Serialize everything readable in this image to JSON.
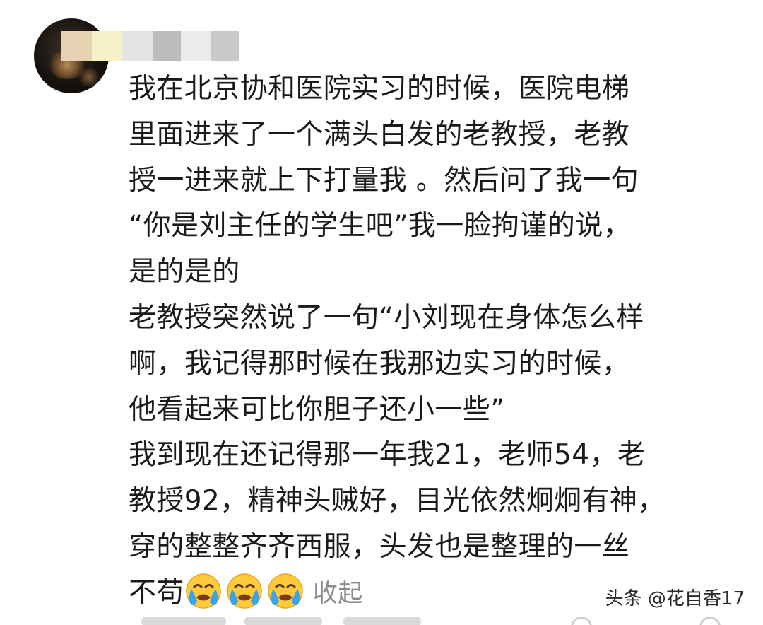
{
  "comment": {
    "lines": [
      "我在北京协和医院实习的时候，医院电梯",
      "里面进来了一个满头白发的老教授，老教",
      "授一进来就上下打量我 。然后问了我一句",
      "“你是刘主任的学生吧”我一脸拘谨的说，",
      "是的是的",
      "老教授突然说了一句“小刘现在身体怎么样",
      "啊，我记得那时候在我那边实习的时候，",
      "他看起来可比你胆子还小一些”",
      "我到现在还记得那一年我21，老师54，老",
      "教授92，精神头贼好，目光依然炯炯有神，",
      "穿的整整齐齐西服，头发也是整理的一丝"
    ],
    "last_line": "不苟",
    "emojis": [
      "crying-emoji",
      "crying-emoji",
      "crying-emoji"
    ],
    "collapse_label": "收起"
  },
  "watermark": "头条 @花自香17",
  "colors": {
    "text": "#1a1a1a",
    "link_gray": "#8c8c8c",
    "emoji_face": "#ffc93c",
    "tear": "#3aa3ea"
  }
}
